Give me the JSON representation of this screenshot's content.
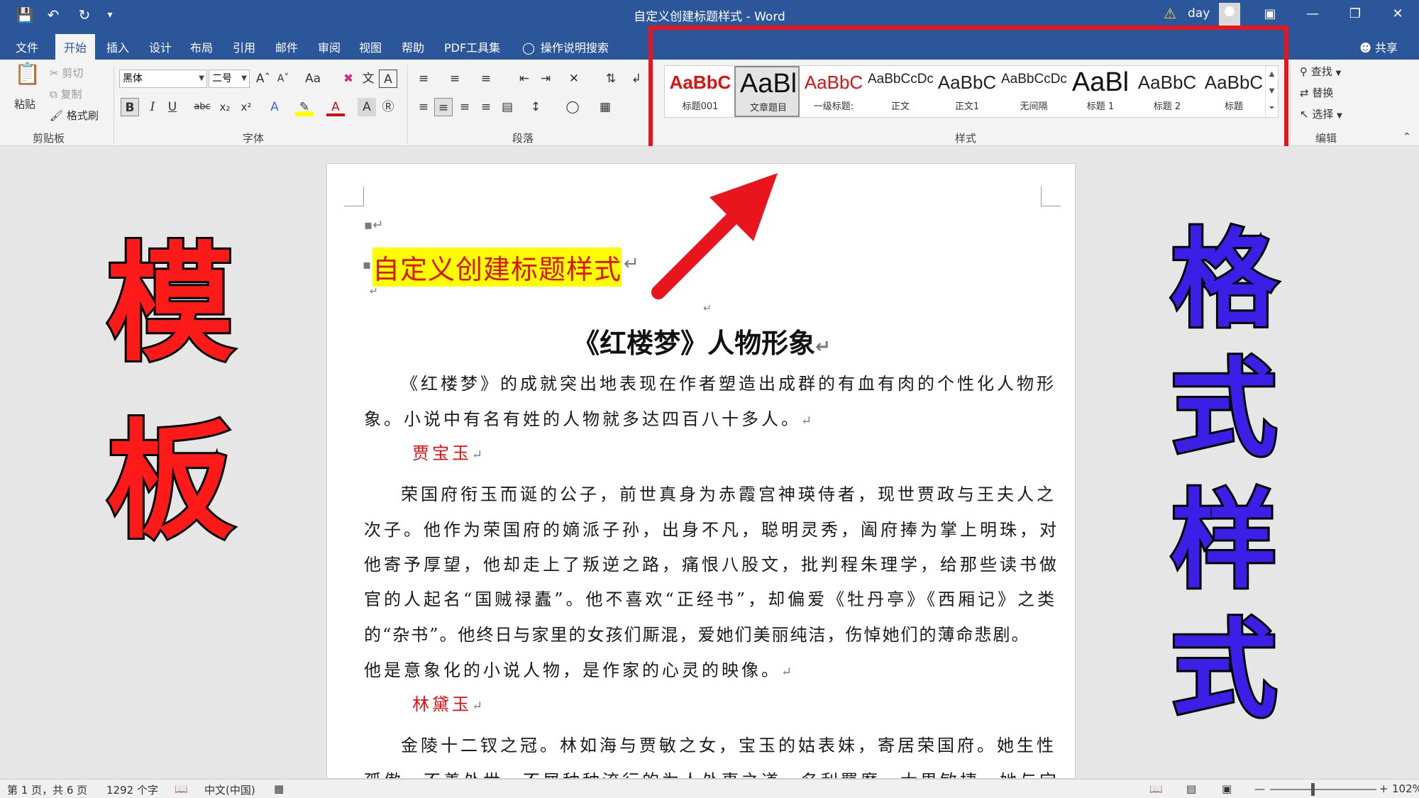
{
  "window": {
    "title": "自定义创建标题样式 - Word",
    "user": "day"
  },
  "tabs": [
    "文件",
    "开始",
    "插入",
    "设计",
    "布局",
    "引用",
    "邮件",
    "审阅",
    "视图",
    "帮助",
    "PDF工具集"
  ],
  "active_tab": "开始",
  "tell_me": "操作说明搜索",
  "share": "共享",
  "clipboard": {
    "paste": "粘贴",
    "cut": "剪切",
    "copy": "复制",
    "format_painter": "格式刷",
    "label": "剪贴板"
  },
  "font": {
    "name": "黑体",
    "size": "二号",
    "label": "字体"
  },
  "paragraph": {
    "label": "段落"
  },
  "styles": {
    "label": "样式",
    "items": [
      {
        "preview": "AaBbC",
        "name": "标题001",
        "color": "#e01010"
      },
      {
        "preview": "AaBl",
        "name": "文章题目",
        "color": "#111111"
      },
      {
        "preview": "AaBbC",
        "name": "一级标题:",
        "color": "#e01010"
      },
      {
        "preview": "AaBbCcDc",
        "name": "正文",
        "color": "#222222"
      },
      {
        "preview": "AaBbC",
        "name": "正文1",
        "color": "#222222"
      },
      {
        "preview": "AaBbCcDc",
        "name": "无间隔",
        "color": "#222222"
      },
      {
        "preview": "AaBl",
        "name": "标题 1",
        "color": "#111111"
      },
      {
        "preview": "AaBbC",
        "name": "标题 2",
        "color": "#222222"
      },
      {
        "preview": "AaBbC",
        "name": "标题",
        "color": "#222222"
      }
    ]
  },
  "editing": {
    "find": "查找",
    "replace": "替换",
    "select": "选择",
    "label": "编辑"
  },
  "document": {
    "highlight_title": "自定义创建标题样式",
    "heading": "《红楼梦》人物形象",
    "lines": [
      "《红楼梦》的成就突出地表现在作者塑造出成群的有血有肉的个性化人物形",
      "象。小说中有名有姓的人物就多达四百八十多人。"
    ],
    "char1": "贾宝玉",
    "para1": [
      "荣国府衔玉而诞的公子，前世真身为赤霞宫神瑛侍者，现世贾政与王夫人之",
      "次子。他作为荣国府的嫡派子孙，出身不凡，聪明灵秀，阖府捧为掌上明珠，对",
      "他寄予厚望，他却走上了叛逆之路，痛恨八股文，批判程朱理学，给那些读书做",
      "官的人起名“国贼禄蠹”。他不喜欢“正经书”，却偏爱《牡丹亭》《西厢记》之类",
      "的“杂书”。他终日与家里的女孩们厮混，爱她们美丽纯洁，伤悼她们的薄命悲剧。",
      "他是意象化的小说人物，是作家的心灵的映像。"
    ],
    "char2": "林黛玉",
    "para2": [
      "金陵十二钗之冠。林如海与贾敏之女，宝玉的姑表妹，寄居荣国府。她生性",
      "孤傲，不善处世，不屑种种流行的为人处事之道，名利羁縻，大男敏捷，她与宝"
    ]
  },
  "overlay": {
    "left": [
      "模",
      "板"
    ],
    "right": [
      "格",
      "式",
      "样",
      "式"
    ]
  },
  "status": {
    "page": "第 1 页，共 6 页",
    "words": "1292 个字",
    "language": "中文(中国)",
    "zoom": "102%"
  }
}
